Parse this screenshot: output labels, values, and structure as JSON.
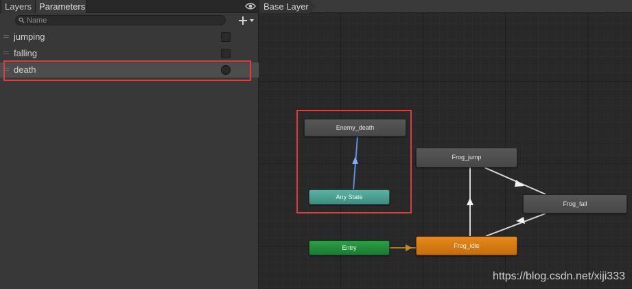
{
  "tabs": {
    "layers": "Layers",
    "parameters": "Parameters"
  },
  "search": {
    "placeholder": "Name",
    "value": ""
  },
  "parameters": [
    {
      "name": "jumping",
      "type": "bool"
    },
    {
      "name": "falling",
      "type": "bool"
    },
    {
      "name": "death",
      "type": "trigger",
      "selected": true
    }
  ],
  "graph": {
    "breadcrumb": "Base Layer",
    "states": {
      "enemy_death": "Enemy_death",
      "any_state": "Any State",
      "entry": "Entry",
      "frog_idle": "Frog_idle",
      "frog_jump": "Frog_jump",
      "frog_fall": "Frog_fall"
    }
  },
  "colors": {
    "highlight": "#e23b3b",
    "any_state": "#4fa596",
    "entry": "#238c3a",
    "default_state": "#d67b14",
    "state": "#4f4f4f",
    "transition": "#d8d8d8",
    "any_transition": "#5b8fd6",
    "entry_transition": "#b07a16"
  },
  "icons": {
    "eye": "eye-icon",
    "search": "search-icon",
    "add": "plus-dropdown-icon"
  },
  "watermark": "https://blog.csdn.net/xiji333"
}
